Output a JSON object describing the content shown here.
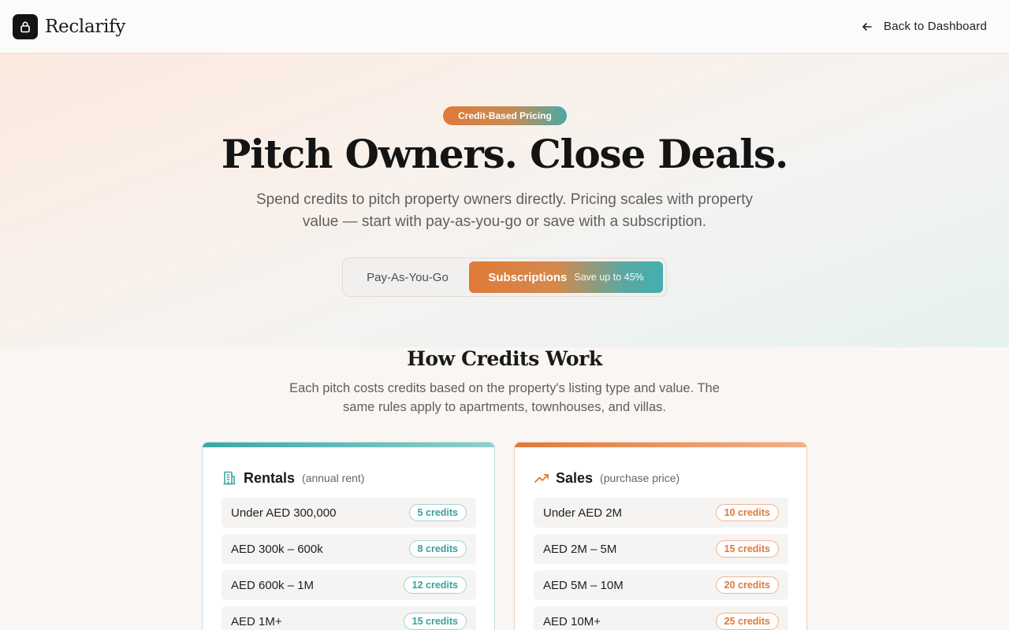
{
  "header": {
    "brand": "Reclarify",
    "logo_icon": "lock-icon",
    "back_label": "Back to Dashboard"
  },
  "hero": {
    "pill": "Credit-Based Pricing",
    "title": "Pitch Owners. Close Deals.",
    "subtitle_line1": "Spend credits to pitch property owners directly. Pricing scales with property",
    "subtitle_line2": "value — start with pay-as-you-go or save with a subscription."
  },
  "toggle": {
    "options": [
      {
        "label": "Pay-As-You-Go",
        "active": false
      },
      {
        "label": "Subscriptions",
        "active": true,
        "note": "Save up to 45%"
      }
    ]
  },
  "how": {
    "title": "How Credits Work",
    "subtitle_line1": "Each pitch costs credits based on the property's listing type and value. The",
    "subtitle_line2": "same rules apply to apartments, townhouses, and villas."
  },
  "cards": [
    {
      "name": "Rentals",
      "note": "(annual rent)",
      "icon": "building-icon",
      "accent": "#3ba8a5",
      "rows": [
        {
          "range": "Under AED 300,000",
          "credits": "5 credits"
        },
        {
          "range": "AED 300k – 600k",
          "credits": "8 credits"
        },
        {
          "range": "AED 600k – 1M",
          "credits": "12 credits"
        },
        {
          "range": "AED 1M+",
          "credits": "15 credits"
        }
      ]
    },
    {
      "name": "Sales",
      "note": "(purchase price)",
      "icon": "trending-up-icon",
      "accent": "#e07a38",
      "rows": [
        {
          "range": "Under AED 2M",
          "credits": "10 credits"
        },
        {
          "range": "AED 2M – 5M",
          "credits": "15 credits"
        },
        {
          "range": "AED 5M – 10M",
          "credits": "20 credits"
        },
        {
          "range": "AED 10M+",
          "credits": "25 credits"
        }
      ]
    }
  ]
}
